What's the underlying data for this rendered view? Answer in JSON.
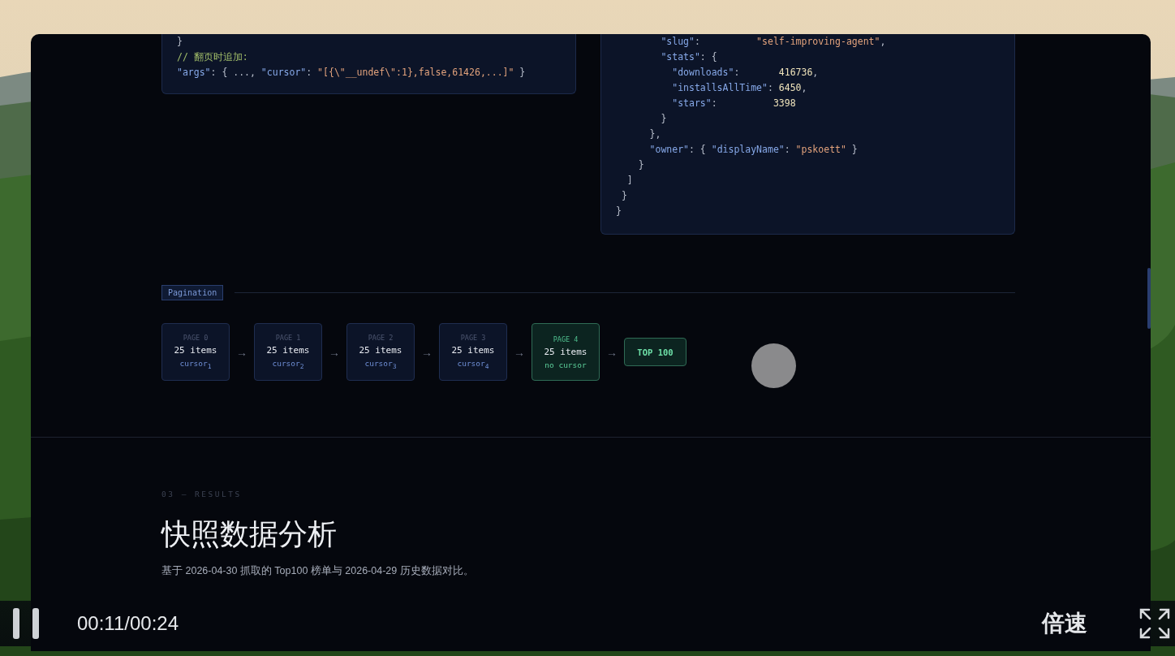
{
  "code_blocks": [
    {
      "lines": [
        [
          {
            "kind": "punc",
            "text": "}"
          }
        ],
        [
          {
            "kind": "comment",
            "text": "// 翻页时追加:"
          }
        ],
        [
          {
            "kind": "key",
            "text": "\"args\""
          },
          {
            "kind": "punc",
            "text": ": { ..., "
          },
          {
            "kind": "key",
            "text": "\"cursor\""
          },
          {
            "kind": "punc",
            "text": ": "
          },
          {
            "kind": "str",
            "text": "\"[{\\\"__undef\\\":1},false,61426,...]\""
          },
          {
            "kind": "punc",
            "text": " }"
          }
        ]
      ]
    },
    {
      "lines": [
        [
          {
            "kind": "key",
            "text": "        \"slug\""
          },
          {
            "kind": "punc",
            "text": ":          "
          },
          {
            "kind": "str",
            "text": "\"self-improving-agent\""
          },
          {
            "kind": "punc",
            "text": ","
          }
        ],
        [
          {
            "kind": "key",
            "text": "        \"stats\""
          },
          {
            "kind": "punc",
            "text": ": {"
          }
        ],
        [
          {
            "kind": "key",
            "text": "          \"downloads\""
          },
          {
            "kind": "punc",
            "text": ":       "
          },
          {
            "kind": "num",
            "text": "416736"
          },
          {
            "kind": "punc",
            "text": ","
          }
        ],
        [
          {
            "kind": "key",
            "text": "          \"installsAllTime\""
          },
          {
            "kind": "punc",
            "text": ": "
          },
          {
            "kind": "num",
            "text": "6450"
          },
          {
            "kind": "punc",
            "text": ","
          }
        ],
        [
          {
            "kind": "key",
            "text": "          \"stars\""
          },
          {
            "kind": "punc",
            "text": ":          "
          },
          {
            "kind": "num",
            "text": "3398"
          }
        ],
        [
          {
            "kind": "punc",
            "text": "        }"
          }
        ],
        [
          {
            "kind": "punc",
            "text": "      },"
          }
        ],
        [
          {
            "kind": "key",
            "text": "      \"owner\""
          },
          {
            "kind": "punc",
            "text": ": { "
          },
          {
            "kind": "key",
            "text": "\"displayName\""
          },
          {
            "kind": "punc",
            "text": ": "
          },
          {
            "kind": "str",
            "text": "\"pskoett\""
          },
          {
            "kind": "punc",
            "text": " }"
          }
        ],
        [
          {
            "kind": "punc",
            "text": "    }"
          }
        ],
        [
          {
            "kind": "punc",
            "text": "  ]"
          }
        ],
        [
          {
            "kind": "punc",
            "text": " }"
          }
        ],
        [
          {
            "kind": "punc",
            "text": "}"
          }
        ]
      ]
    }
  ],
  "pagination": {
    "tag": "Pagination",
    "steps": [
      {
        "kind": "page",
        "page": "PAGE 0",
        "items": "25 items",
        "cursor": "cursor$_{1}$"
      },
      {
        "kind": "page",
        "page": "PAGE 1",
        "items": "25 items",
        "cursor": "cursor$_{2}$"
      },
      {
        "kind": "page",
        "page": "PAGE 2",
        "items": "25 items",
        "cursor": "cursor$_{3}$"
      },
      {
        "kind": "page",
        "page": "PAGE 3",
        "items": "25 items",
        "cursor": "cursor$_{4}$"
      },
      {
        "kind": "last",
        "page": "PAGE 4",
        "items": "25 items",
        "cursor": "no cursor"
      },
      {
        "kind": "result",
        "label": "TOP 100"
      }
    ],
    "arrow": "→"
  },
  "results": {
    "eyebrow": "03 — RESULTS",
    "title": "快照数据分析",
    "description": "基于 2026-04-30 抓取的 Top100 榜单与 2026-04-29 历史数据对比。"
  },
  "player": {
    "time": "00:11/00:24",
    "speed": "倍速"
  }
}
